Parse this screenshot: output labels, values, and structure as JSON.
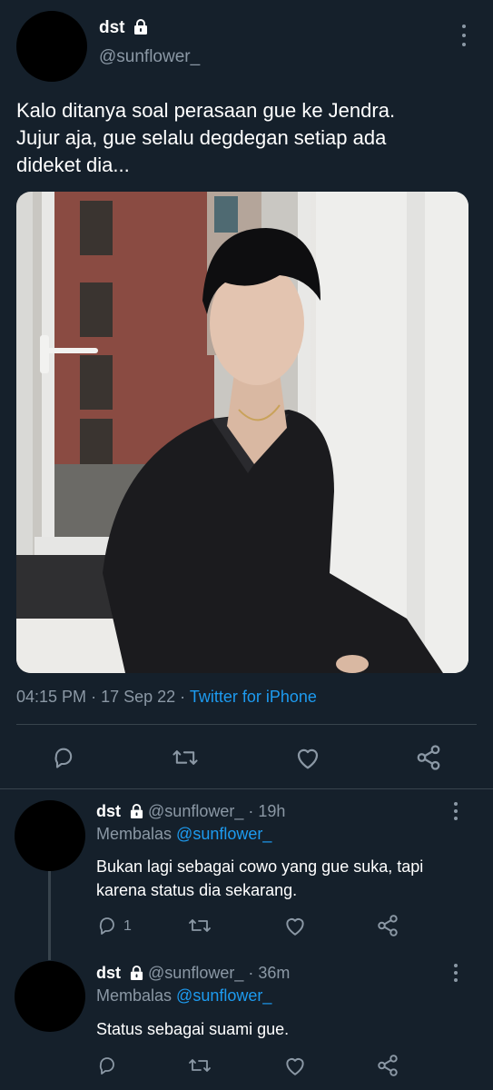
{
  "tweet": {
    "display_name": "dst",
    "handle": "@sunflower_",
    "text_line1": "Kalo ditanya soal perasaan gue ke Jendra.",
    "text_line2": "Jujur aja, gue selalu degdegan setiap ada",
    "text_line3": "dideket dia...",
    "time": "04:15 PM",
    "date": "17 Sep 22",
    "source": "Twitter for iPhone",
    "actions": {
      "reply_icon": "reply-icon",
      "retweet_icon": "retweet-icon",
      "like_icon": "like-icon",
      "share_icon": "share-icon"
    }
  },
  "replies": [
    {
      "display_name": "dst",
      "handle": "@sunflower_",
      "time_ago": "19h",
      "replying_prefix": "Membalas",
      "replying_to": "@sunflower_",
      "text_line1": "Bukan lagi sebagai cowo yang gue suka, tapi",
      "text_line2": "karena status dia sekarang.",
      "reply_count": "1"
    },
    {
      "display_name": "dst",
      "handle": "@sunflower_",
      "time_ago": "36m",
      "replying_prefix": "Membalas",
      "replying_to": "@sunflower_",
      "text_line1": "Status sebagai suami gue."
    }
  ],
  "colors": {
    "background": "#15202b",
    "accent": "#1d9bf0",
    "muted": "#8b98a5",
    "divider": "#38444d"
  }
}
